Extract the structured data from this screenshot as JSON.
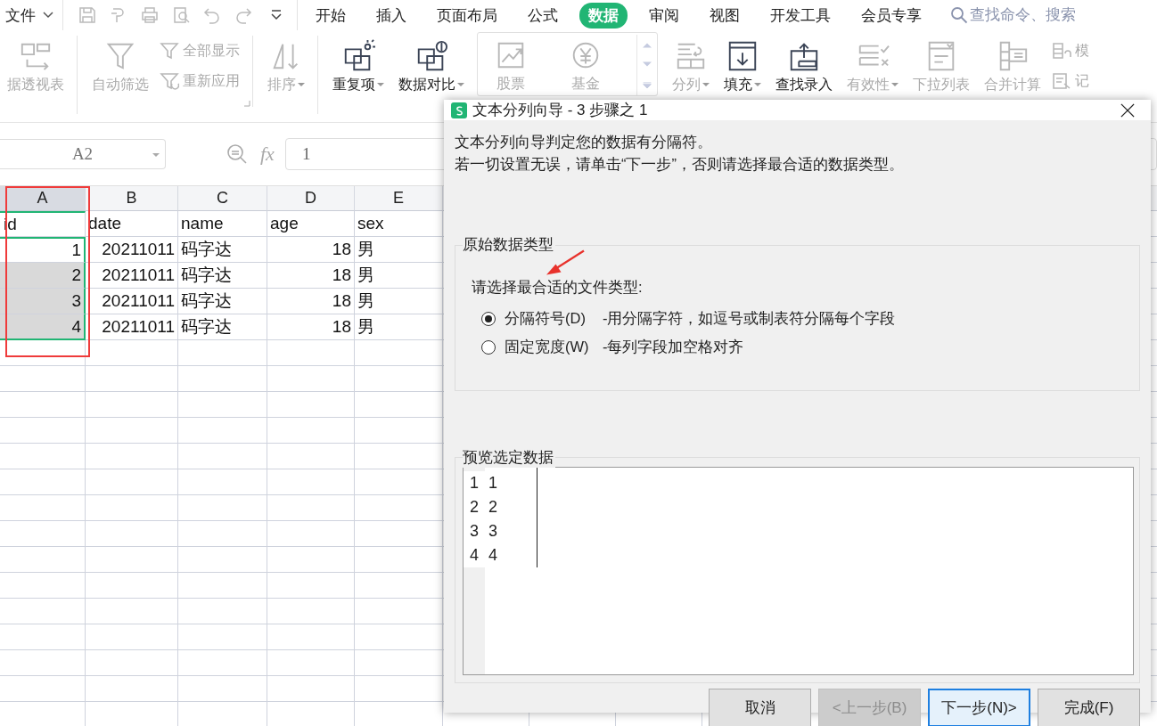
{
  "menu": {
    "file": "文件",
    "tabs": [
      {
        "label": "开始",
        "selected": false
      },
      {
        "label": "插入",
        "selected": false
      },
      {
        "label": "页面布局",
        "selected": false
      },
      {
        "label": "公式",
        "selected": false
      },
      {
        "label": "数据",
        "selected": true
      },
      {
        "label": "审阅",
        "selected": false
      },
      {
        "label": "视图",
        "selected": false
      },
      {
        "label": "开发工具",
        "selected": false
      },
      {
        "label": "会员专享",
        "selected": false
      }
    ]
  },
  "search": {
    "placeholder": "查找命令、搜索"
  },
  "ribbon": {
    "items": [
      {
        "kind": "large",
        "label": "据透视表",
        "disabled": true,
        "caret": false,
        "divider_after": true
      },
      {
        "kind": "large",
        "label": "自动筛选",
        "disabled": true,
        "caret": false,
        "divider_after": false
      },
      {
        "kind": "pair",
        "labels": [
          "全部显示",
          "重新应用"
        ],
        "disabled": true,
        "divider_after": true
      },
      {
        "kind": "large",
        "label": "排序",
        "disabled": true,
        "caret": true,
        "divider_after": true
      },
      {
        "kind": "large",
        "label": "重复项",
        "disabled": false,
        "caret": true,
        "divider_after": false
      },
      {
        "kind": "large",
        "label": "数据对比",
        "disabled": false,
        "caret": true,
        "divider_after": false
      },
      {
        "kind": "gallery",
        "labels": [
          "股票",
          "基金"
        ],
        "disabled": true,
        "divider_after": false
      },
      {
        "kind": "large",
        "label": "分列",
        "disabled": true,
        "caret": true,
        "divider_after": false
      },
      {
        "kind": "large",
        "label": "填充",
        "disabled": false,
        "caret": true,
        "divider_after": false
      },
      {
        "kind": "large",
        "label": "查找录入",
        "disabled": false,
        "caret": false,
        "divider_after": false
      },
      {
        "kind": "large",
        "label": "有效性",
        "disabled": true,
        "caret": true,
        "divider_after": false
      },
      {
        "kind": "large",
        "label": "下拉列表",
        "disabled": true,
        "caret": false,
        "divider_after": false
      },
      {
        "kind": "large",
        "label": "合并计算",
        "disabled": true,
        "caret": false,
        "divider_after": false
      },
      {
        "kind": "pair",
        "labels": [
          "模",
          "记"
        ],
        "disabled": true
      }
    ]
  },
  "formula_bar": {
    "name_box": "A2",
    "fx": "fx",
    "value": "1"
  },
  "sheet": {
    "columns": [
      {
        "label": "A",
        "selected": true,
        "numeric": true
      },
      {
        "label": "B",
        "selected": false,
        "numeric": true
      },
      {
        "label": "C",
        "selected": false,
        "numeric": false
      },
      {
        "label": "D",
        "selected": false,
        "numeric": true
      },
      {
        "label": "E",
        "selected": false,
        "numeric": false
      }
    ],
    "rows": [
      {
        "kind": "header",
        "cells": [
          "id",
          "date",
          "name",
          "age",
          "sex"
        ]
      },
      {
        "kind": "data",
        "selected": true,
        "active": true,
        "cells": [
          "1",
          "20211011",
          "码字达",
          "18",
          "男"
        ]
      },
      {
        "kind": "data",
        "selected": true,
        "active": false,
        "cells": [
          "2",
          "20211011",
          "码字达",
          "18",
          "男"
        ]
      },
      {
        "kind": "data",
        "selected": true,
        "active": false,
        "cells": [
          "3",
          "20211011",
          "码字达",
          "18",
          "男"
        ]
      },
      {
        "kind": "data",
        "selected": true,
        "active": false,
        "cells": [
          "4",
          "20211011",
          "码字达",
          "18",
          "男"
        ]
      }
    ]
  },
  "dialog": {
    "title": "文本分列向导 - 3 步骤之 1",
    "lines": [
      "文本分列向导判定您的数据有分隔符。",
      "若一切设置无误，请单击“下一步”，否则请选择最合适的数据类型。"
    ],
    "group_title": "原始数据类型",
    "prompt": "请选择最合适的文件类型:",
    "options": [
      {
        "label": "分隔符号(D)",
        "hint": "-用分隔字符，如逗号或制表符分隔每个字段",
        "selected": true
      },
      {
        "label": "固定宽度(W)",
        "hint": "-每列字段加空格对齐",
        "selected": false
      }
    ],
    "preview_title": "预览选定数据",
    "preview_rows": [
      {
        "number": "1",
        "value": "1"
      },
      {
        "number": "2",
        "value": "2"
      },
      {
        "number": "3",
        "value": "3"
      },
      {
        "number": "4",
        "value": "4"
      }
    ],
    "buttons": [
      {
        "label": "取消",
        "disabled": false,
        "default": false
      },
      {
        "label": "<上一步(B)",
        "disabled": true,
        "default": false
      },
      {
        "label": "下一步(N)>",
        "disabled": false,
        "default": true
      },
      {
        "label": "完成(F)",
        "disabled": false,
        "default": false
      }
    ]
  }
}
